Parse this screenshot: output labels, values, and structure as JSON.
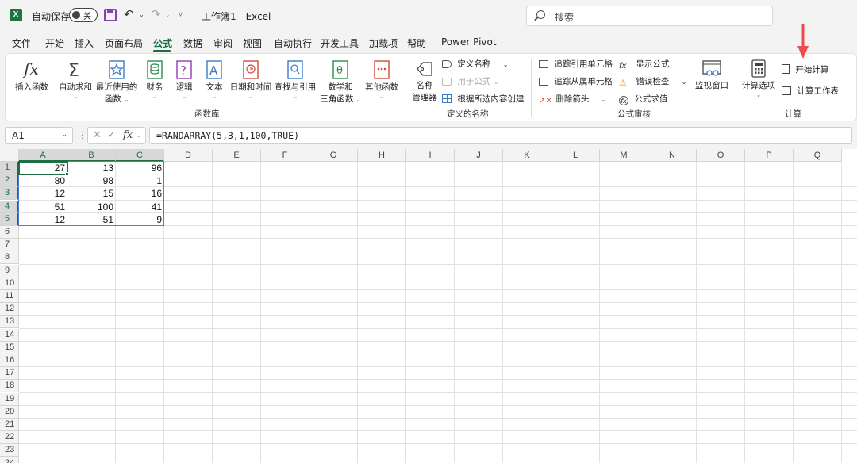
{
  "titlebar": {
    "logo": "X",
    "autosave_label": "自动保存",
    "autosave_state": "关",
    "title": "工作簿1  -  Excel"
  },
  "search": {
    "placeholder": "搜索"
  },
  "menu": {
    "tabs": [
      "文件",
      "开始",
      "插入",
      "页面布局",
      "公式",
      "数据",
      "审阅",
      "视图",
      "自动执行",
      "开发工具",
      "加载项",
      "帮助",
      "Power Pivot"
    ],
    "active": "公式"
  },
  "ribbon": {
    "function_library": {
      "group_label": "函数库",
      "insert_function": "插入函数",
      "autosum": "自动求和",
      "recent_line1": "最近使用的",
      "recent_line2": "函数",
      "financial": "财务",
      "logical": "逻辑",
      "text": "文本",
      "datetime": "日期和时间",
      "lookup": "查找与引用",
      "math_line1": "数学和",
      "math_line2": "三角函数",
      "more": "其他函数"
    },
    "defined_names": {
      "group_label": "定义的名称",
      "name_manager_line1": "名称",
      "name_manager_line2": "管理器",
      "define_name": "定义名称",
      "use_in_formula": "用于公式",
      "create_from_selection": "根据所选内容创建"
    },
    "formula_auditing": {
      "group_label": "公式审核",
      "trace_precedents": "追踪引用单元格",
      "trace_dependents": "追踪从属单元格",
      "remove_arrows": "删除箭头",
      "show_formulas": "显示公式",
      "error_checking": "错误检查",
      "evaluate_formula": "公式求值",
      "watch_window": "监视窗口"
    },
    "calculation": {
      "group_label": "计算",
      "calc_options": "计算选项",
      "calc_now": "开始计算",
      "calc_sheet": "计算工作表"
    }
  },
  "formula_bar": {
    "name_box": "A1",
    "fx": "fx",
    "formula": "=RANDARRAY(5,3,1,100,TRUE)"
  },
  "sheet": {
    "columns": [
      "A",
      "B",
      "C",
      "D",
      "E",
      "F",
      "G",
      "H",
      "I",
      "J",
      "K",
      "L",
      "M",
      "N",
      "O",
      "P",
      "Q"
    ],
    "rows": [
      "1",
      "2",
      "3",
      "4",
      "5",
      "6",
      "7",
      "8",
      "9",
      "10",
      "11",
      "12",
      "13",
      "14",
      "15",
      "16",
      "17",
      "18",
      "19",
      "20",
      "21",
      "22",
      "23",
      "24"
    ],
    "values": [
      [
        "27",
        "13",
        "96"
      ],
      [
        "80",
        "98",
        "1"
      ],
      [
        "12",
        "15",
        "16"
      ],
      [
        "51",
        "100",
        "41"
      ],
      [
        "12",
        "51",
        "9"
      ]
    ],
    "active_cell": "A1",
    "selected_range": "A1:C5"
  },
  "colors": {
    "accent": "#1e6e43",
    "selection_border": "#4a7fd0",
    "annotation_arrow": "#f04a4a"
  }
}
